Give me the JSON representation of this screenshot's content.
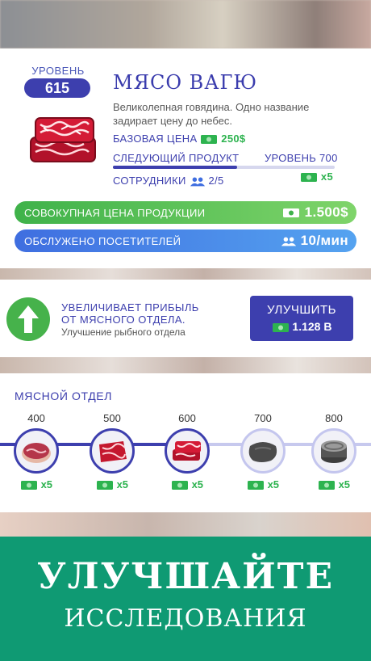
{
  "product": {
    "level_label": "УРОВЕНЬ",
    "level": "615",
    "title": "МЯСО ВАГЮ",
    "description": "Великолепная говядина. Одно название задирает цену до небес.",
    "base_price_label": "БАЗОВАЯ ЦЕНА",
    "base_price": "250$",
    "next_product_label": "СЛЕДУЮЩИЙ ПРОДУКТ",
    "next_level": "УРОВЕНЬ 700",
    "next_multiplier": "x5",
    "next_progress": 0.56,
    "staff_label": "СОТРУДНИКИ",
    "staff": "2/5",
    "total_price_label": "СОВОКУПНАЯ ЦЕНА ПРОДУКЦИИ",
    "total_price": "1.500$",
    "served_label": "ОБСЛУЖЕНО ПОСЕТИТЕЛЕЙ",
    "served": "10/мин",
    "icon": "wagyu-meat-icon"
  },
  "upgrade": {
    "line1": "УВЕЛИЧИВАЕТ ПРИБЫЛЬ",
    "line2": "ОТ МЯСНОГО ОТДЕЛА.",
    "subtitle": "Улучшение рыбного отдела",
    "button_label": "УЛУЧШИТЬ",
    "price": "1.128 B",
    "icon": "arrow-up-icon"
  },
  "department": {
    "title": "МЯСНОЙ ОТДЕЛ",
    "nodes": [
      {
        "level": "400",
        "multiplier": "x5",
        "icon": "steak-icon",
        "unlocked": true
      },
      {
        "level": "500",
        "multiplier": "x5",
        "icon": "marbled-beef-icon",
        "unlocked": true
      },
      {
        "level": "600",
        "multiplier": "x5",
        "icon": "wagyu-meat-icon",
        "unlocked": true
      },
      {
        "level": "700",
        "multiplier": "x5",
        "icon": "dark-meat-icon",
        "unlocked": false
      },
      {
        "level": "800",
        "multiplier": "x5",
        "icon": "canned-meat-icon",
        "unlocked": false
      }
    ]
  },
  "banner": {
    "title": "УЛУЧШАЙТЕ",
    "subtitle": "ИССЛЕДОВАНИЯ"
  },
  "colors": {
    "primary": "#3d3fae",
    "green": "#2db34f",
    "banner": "#0f9a73"
  }
}
